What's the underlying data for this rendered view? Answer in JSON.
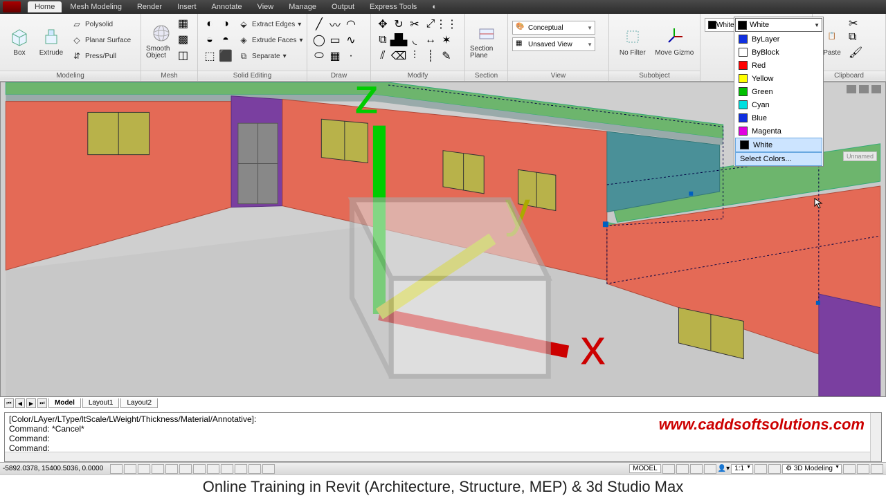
{
  "tabs": [
    "Home",
    "Mesh Modeling",
    "Render",
    "Insert",
    "Annotate",
    "View",
    "Manage",
    "Output",
    "Express Tools"
  ],
  "active_tab": "Home",
  "panels": {
    "modeling": {
      "label": "Modeling",
      "box": "Box",
      "extrude": "Extrude",
      "polysolid": "Polysolid",
      "planar": "Planar Surface",
      "presspull": "Press/Pull"
    },
    "mesh": {
      "label": "Mesh",
      "smooth": "Smooth Object"
    },
    "solid": {
      "label": "Solid Editing",
      "extract": "Extract Edges",
      "faces": "Extrude Faces",
      "separate": "Separate"
    },
    "draw": {
      "label": "Draw"
    },
    "modify": {
      "label": "Modify"
    },
    "section": {
      "label": "Section",
      "plane": "Section Plane"
    },
    "view": {
      "label": "View",
      "visual": "Conceptual",
      "saved": "Unsaved View"
    },
    "subobject": {
      "label": "Subobject",
      "nofilter": "No Filter",
      "gizmo": "Move Gizmo"
    },
    "clipboard": {
      "label": "Clipboard",
      "paste": "Paste"
    }
  },
  "color_dropdown": {
    "selected": "White",
    "items": [
      {
        "name": "ByLayer",
        "hex": "#1030e0"
      },
      {
        "name": "ByBlock",
        "hex": "#ffffff"
      },
      {
        "name": "Red",
        "hex": "#ff0000"
      },
      {
        "name": "Yellow",
        "hex": "#ffff00"
      },
      {
        "name": "Green",
        "hex": "#00c000"
      },
      {
        "name": "Cyan",
        "hex": "#00e0e0"
      },
      {
        "name": "Blue",
        "hex": "#1030e0"
      },
      {
        "name": "Magenta",
        "hex": "#e000e0"
      },
      {
        "name": "White",
        "hex": "#000000"
      }
    ],
    "more": "Select Colors..."
  },
  "viewcube_label": "Unnamed",
  "layout_tabs": [
    "Model",
    "Layout1",
    "Layout2"
  ],
  "command_lines": [
    "[Color/LAyer/LType/ltScale/LWeight/Thickness/Material/Annotative]:",
    "Command: *Cancel*",
    "Command:",
    "Command:"
  ],
  "watermark": "www.caddsoftsolutions.com",
  "status": {
    "coords": "-5892.0378, 15400.5036, 0.0000",
    "model": "MODEL",
    "scale": "1:1",
    "workspace": "3D Modeling"
  },
  "banner": "Online Training in Revit (Architecture, Structure, MEP) & 3d Studio Max"
}
